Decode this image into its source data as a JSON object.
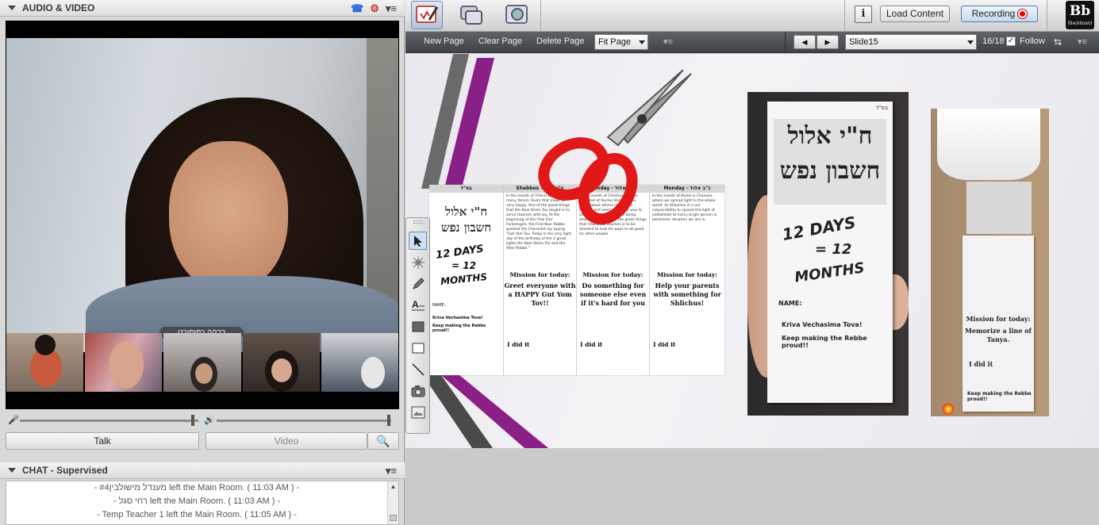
{
  "audio_video": {
    "title": "AUDIO & VIDEO",
    "speaker_name": "רבקה רפופורט",
    "talk_label": "Talk",
    "video_label": "Video"
  },
  "chat": {
    "title": "CHAT - Supervised",
    "messages": [
      "- מענדל מישולבין#4  left the Main Room. ( 11:03 AM ) -",
      "- רחי סגל left the Main Room. ( 11:03 AM ) -",
      "- Temp Teacher 1 left the Main Room. ( 11:05 AM ) -"
    ]
  },
  "topbar": {
    "info_label": "i",
    "load_content": "Load Content",
    "recording": "Recording",
    "logo_text": "Bb",
    "logo_sub": "Blackboard"
  },
  "whiteboard_toolbar": {
    "new_page": "New Page",
    "clear_page": "Clear Page",
    "delete_page": "Delete Page",
    "zoom_value": "Fit Page",
    "slide_value": "Slide15",
    "page_count": "16/18",
    "follow_label": "Follow"
  },
  "slide": {
    "days_title": "12 DAYS",
    "equals": "= 12",
    "months": "MONTHS",
    "hebrew_title_1": "ח\"י אלול",
    "hebrew_title_2": "חשבון נפש",
    "columns": [
      {
        "head": "בס\"ד",
        "mission": "",
        "text": ""
      },
      {
        "head": "Shabbos - ח\"י אלול",
        "mission": "Greet everyone with a HAPPY Gut Yom Tov!!",
        "text": "In the month of Tishrei we have many Yomim Tovim that make us very happy. One of the great things that the Baal Shem Tov taught is to serve Hashem with joy. At the beginning of the Chai Elul Farbrengen, the Frierdiker Rebbe greeted the Chassidim by saying \"Gut Yom Tov. Today is the very light day of the birthday of the 2 great lights the Baal Shem Tov and the Alter Rebbe.\""
      },
      {
        "head": "Sunday - כ\"ט אלול",
        "mission": "Do something for someone else even if it's hard for you",
        "text": "In the month of Cheshvan, is the yahrtzeit of Rochel Imeinu, who cared about others more than herself, and went out of her way to save her sister Leah from being embarrassed. One of the great things that Chassidus teaches is to be devoted to look for ways to do good for other people."
      },
      {
        "head": "Monday - כ\"ב אלול",
        "mission": "Help your parents with something for Shlichus!",
        "text": "In the month of Kislev is Chanuka where we spread light to the whole world. As Shluchos it is our responsibility to spread the light of yiddishkeit to every single person in whichever situation we are in."
      }
    ],
    "mission_heading": "Mission for today:",
    "did_it": "I did it",
    "name_label": "NAME:",
    "kesiva": "Kriva Vechasima Tova!",
    "keep_making": "Keep making the Rebbe proud!!",
    "tanya_mission": "Memorize a line of Tanya.",
    "tanya_heading": "Mission for today:",
    "tanya_did": "I did it",
    "tanya_keep": "Keep making the Rebbe proud!!",
    "photo_name": "NAME:",
    "photo_kesiva": "Kriva Vechasima Tova!",
    "photo_keep": "Keep making the Rebbe proud!!",
    "photo_head": "בס\"ד"
  },
  "colors": {
    "accent_purple": "#8a1f86",
    "stripe_gray": "#555555",
    "scissors_red": "#e01818",
    "record_red": "#e00000"
  },
  "icons": {
    "whiteboard": "whiteboard-pen-icon",
    "app_share": "application-share-icon",
    "web_tour": "web-tour-icon"
  }
}
